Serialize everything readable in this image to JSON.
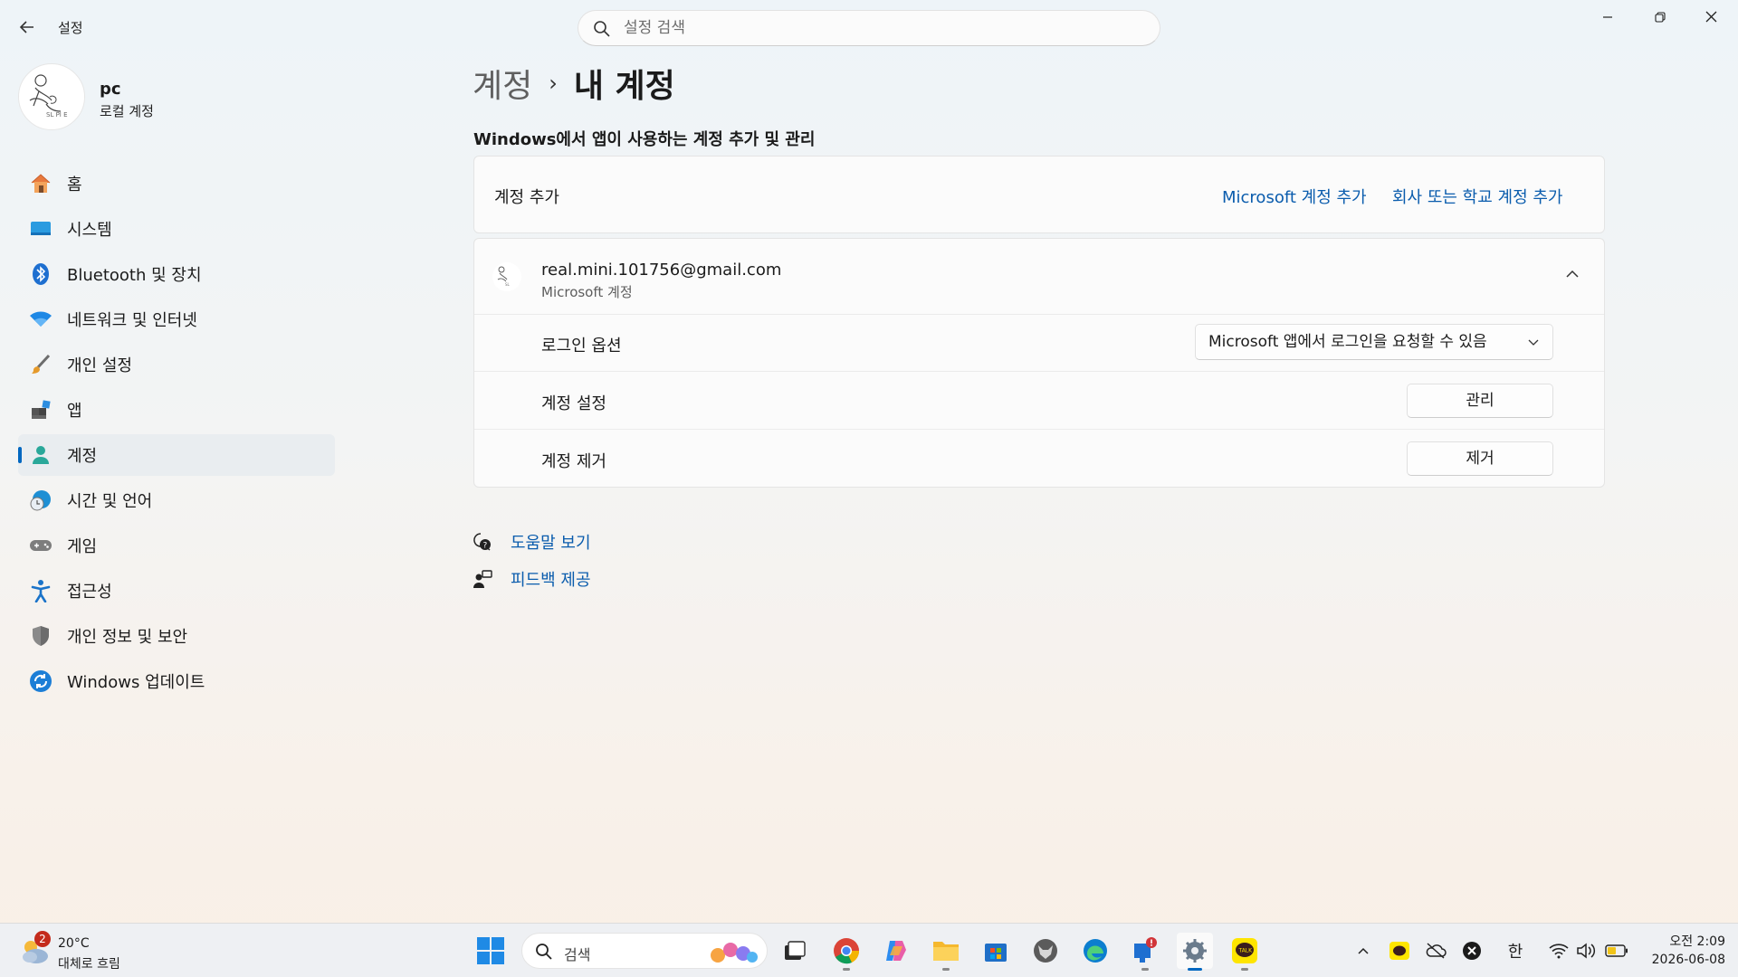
{
  "titlebar": {
    "app_title": "설정",
    "search_placeholder": "설정 검색"
  },
  "profile": {
    "name": "pc",
    "account_type": "로컬 계정"
  },
  "nav": {
    "items": [
      {
        "label": "홈",
        "icon": "home-icon"
      },
      {
        "label": "시스템",
        "icon": "system-icon"
      },
      {
        "label": "Bluetooth 및 장치",
        "icon": "bluetooth-icon"
      },
      {
        "label": "네트워크 및 인터넷",
        "icon": "wifi-icon"
      },
      {
        "label": "개인 설정",
        "icon": "brush-icon"
      },
      {
        "label": "앱",
        "icon": "apps-icon"
      },
      {
        "label": "계정",
        "icon": "person-icon",
        "active": true
      },
      {
        "label": "시간 및 언어",
        "icon": "clock-globe-icon"
      },
      {
        "label": "게임",
        "icon": "gamepad-icon"
      },
      {
        "label": "접근성",
        "icon": "accessibility-icon"
      },
      {
        "label": "개인 정보 및 보안",
        "icon": "shield-icon"
      },
      {
        "label": "Windows 업데이트",
        "icon": "update-icon"
      }
    ]
  },
  "main": {
    "breadcrumb_parent": "계정",
    "breadcrumb_separator": "›",
    "breadcrumb_current": "내 계정",
    "section_title": "Windows에서 앱이 사용하는 계정 추가 및 관리",
    "add_account": {
      "label": "계정 추가",
      "microsoft_link": "Microsoft 계정 추가",
      "work_school_link": "회사 또는 학교 계정 추가"
    },
    "account": {
      "email": "real.mini.101756@gmail.com",
      "type": "Microsoft 계정",
      "signin_label": "로그인 옵션",
      "signin_value": "Microsoft 앱에서 로그인을 요청할 수 있음",
      "settings_label": "계정 설정",
      "settings_button": "관리",
      "remove_label": "계정 제거",
      "remove_button": "제거"
    },
    "help": {
      "get_help": "도움말 보기",
      "feedback": "피드백 제공"
    }
  },
  "taskbar": {
    "weather_badge": "2",
    "temperature": "20°C",
    "weather_desc": "대체로 흐림",
    "search_label": "검색",
    "ime": "한",
    "time": "오전 2:09",
    "date": "2026-06-08",
    "colors": {
      "accent": "#0067c0",
      "link": "#0a5cad"
    }
  }
}
